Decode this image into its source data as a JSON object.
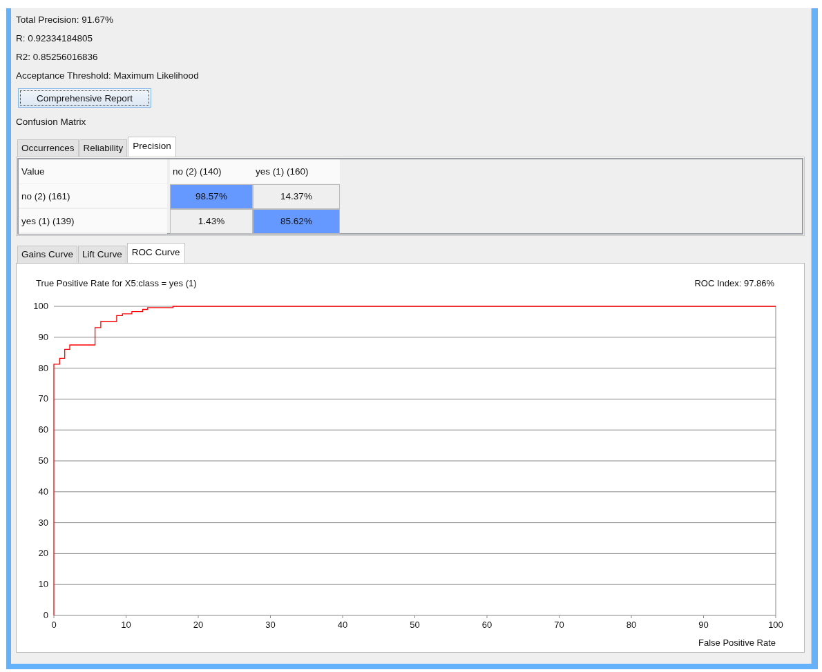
{
  "stats": [
    "Total Precision: 91.67%",
    "R: 0.92334184805",
    "R2: 0.85256016836",
    "Acceptance Threshold: Maximum Likelihood"
  ],
  "report_button": "Comprehensive Report",
  "matrix_title": "Confusion Matrix",
  "matrix_tabs": [
    {
      "label": "Occurrences",
      "selected": false
    },
    {
      "label": "Reliability",
      "selected": false
    },
    {
      "label": "Precision",
      "selected": true
    }
  ],
  "matrix": {
    "columns": [
      "Value",
      "no (2) (140)",
      "yes (1) (160)"
    ],
    "rows": [
      {
        "cells": [
          {
            "text": "no (2) (161)",
            "highlighted": false
          },
          {
            "text": "98.57%",
            "highlighted": true
          },
          {
            "text": "14.37%",
            "highlighted": false
          }
        ]
      },
      {
        "cells": [
          {
            "text": "yes (1) (139)",
            "highlighted": false
          },
          {
            "text": "1.43%",
            "highlighted": false
          },
          {
            "text": "85.62%",
            "highlighted": true
          }
        ]
      }
    ]
  },
  "curve_tabs": [
    {
      "label": "Gains Curve",
      "selected": false
    },
    {
      "label": "Lift Curve",
      "selected": false
    },
    {
      "label": "ROC Curve",
      "selected": true
    }
  ],
  "roc": {
    "roc_index": "ROC Index: 97.86%",
    "chart_data": {
      "type": "line",
      "ylabel": "True Positive Rate for X5:class = yes (1)",
      "xlabel": "False Positive Rate",
      "x": [
        0,
        0,
        0.8,
        0.8,
        1.5,
        1.5,
        2.2,
        2.2,
        5.7,
        5.7,
        6.5,
        6.5,
        8.7,
        8.7,
        9.5,
        9.5,
        10.8,
        10.8,
        12.3,
        12.3,
        13,
        13,
        16.5,
        16.5,
        100
      ],
      "series": [
        {
          "color": "#ff0000",
          "values": [
            0,
            81.3,
            81.3,
            83.2,
            83.2,
            86.1,
            86.1,
            87.5,
            87.5,
            93.1,
            93.1,
            95.1,
            95.1,
            97,
            97,
            97.6,
            97.6,
            98.3,
            98.3,
            99,
            99,
            99.6,
            99.6,
            100,
            100
          ]
        }
      ],
      "grid": true,
      "xlim": [
        0,
        100
      ],
      "ylim": [
        0,
        100
      ],
      "xticks": [
        0,
        10,
        20,
        30,
        40,
        50,
        60,
        70,
        80,
        90,
        100
      ],
      "yticks": [
        0,
        10,
        20,
        30,
        40,
        50,
        60,
        70,
        80,
        90,
        100
      ]
    }
  }
}
